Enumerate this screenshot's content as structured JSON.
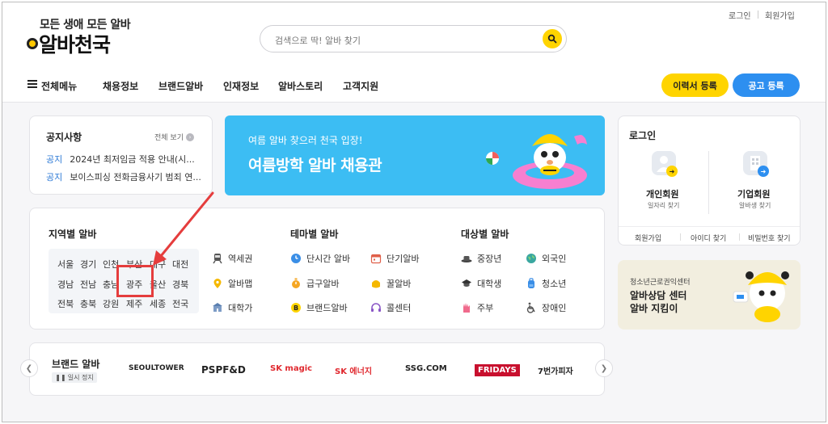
{
  "header": {
    "slogan": "모든 생애 모든 알바",
    "logo": "알바천국",
    "util_links": [
      "로그인",
      "회원가입"
    ],
    "search_placeholder": "검색으로 딱! 알바 찾기"
  },
  "nav": {
    "items": [
      "전체메뉴",
      "채용정보",
      "브랜드알바",
      "인재정보",
      "알바스토리",
      "고객지원"
    ],
    "resume_button": "이력서 등록",
    "post_button": "공고 등록"
  },
  "notice": {
    "title": "공지사항",
    "more": "전체 보기",
    "rows": [
      {
        "tag": "공지",
        "text": "2024년 최저임금 적용 안내(시..."
      },
      {
        "tag": "공지",
        "text": "보이스피싱 전화금융사기 범죄 연..."
      }
    ]
  },
  "banner": {
    "subtitle": "여름 알바 찾으러 천국 입장!",
    "title": "여름방학 알바 채용관"
  },
  "categories": {
    "region_title": "지역별 알바",
    "regions": [
      [
        "서울",
        "경기",
        "인천",
        "부산",
        "대구",
        "대전"
      ],
      [
        "경남",
        "전남",
        "충남",
        "광주",
        "울산",
        "경북"
      ],
      [
        "전북",
        "충북",
        "강원",
        "제주",
        "세종",
        "전국"
      ]
    ],
    "region_extra": [
      "역세권",
      "알바맵",
      "대학가"
    ],
    "theme_title": "테마별 알바",
    "theme_col1": [
      "단시간 알바",
      "급구알바",
      "브랜드알바"
    ],
    "theme_col2": [
      "단기알바",
      "꿀알바",
      "콜센터"
    ],
    "target_title": "대상별 알바",
    "target_col1": [
      "중장년",
      "대학생",
      "주부"
    ],
    "target_col2": [
      "외국인",
      "청소년",
      "장애인"
    ]
  },
  "brand": {
    "title": "브랜드 알바",
    "pause": "일시 정지",
    "logos": [
      "SEOULTOWER",
      "PSPF&D",
      "SK magic",
      "SK 에너지",
      "SSG.COM",
      "FRIDAYS",
      "7번가피자"
    ]
  },
  "login": {
    "title": "로그인",
    "personal_name": "개인회원",
    "personal_sub": "일자리 찾기",
    "company_name": "기업회원",
    "company_sub": "알바생 찾기",
    "links": [
      "회원가입",
      "아이디 찾기",
      "비밀번호 찾기"
    ]
  },
  "counsel": {
    "subtitle": "청소년근로권익센터",
    "title_line1": "알바상담 센터",
    "title_line2": "알바 지킴이"
  },
  "colors": {
    "accent_yellow": "#ffd400",
    "accent_blue": "#2d8ff0",
    "banner_blue": "#3cbdf3",
    "highlight_red": "#e53d3d"
  }
}
